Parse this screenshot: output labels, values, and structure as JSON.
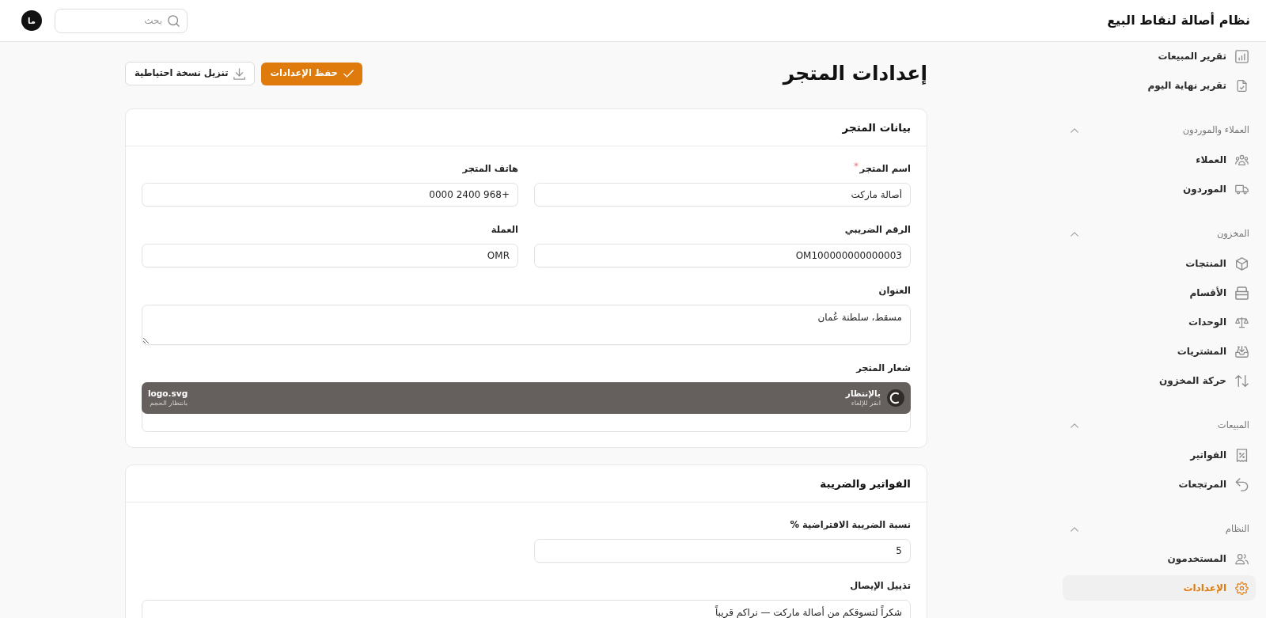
{
  "app": {
    "title": "نظام أصالة لنقاط البيع"
  },
  "search": {
    "placeholder": "بحث"
  },
  "user": {
    "initials": "ما"
  },
  "sidebar": {
    "sections": [
      {
        "items": [
          {
            "label": "تقرير المبيعات",
            "selected": false
          },
          {
            "label": "تقرير نهاية اليوم",
            "selected": false
          }
        ]
      },
      {
        "title": "العملاء والموردون",
        "expanded": true,
        "items": [
          {
            "label": "العملاء",
            "selected": false
          },
          {
            "label": "الموردون",
            "selected": false
          }
        ]
      },
      {
        "title": "المخزون",
        "expanded": true,
        "items": [
          {
            "label": "المنتجات",
            "selected": false
          },
          {
            "label": "الأقسام",
            "selected": false
          },
          {
            "label": "الوحدات",
            "selected": false
          },
          {
            "label": "المشتريات",
            "selected": false
          },
          {
            "label": "حركة المخزون",
            "selected": false
          }
        ]
      },
      {
        "title": "المبيعات",
        "expanded": true,
        "items": [
          {
            "label": "الفواتير",
            "selected": false
          },
          {
            "label": "المرتجعات",
            "selected": false
          }
        ]
      },
      {
        "title": "النظام",
        "expanded": true,
        "items": [
          {
            "label": "المستخدمون",
            "selected": false
          },
          {
            "label": "الإعدادات",
            "selected": true
          }
        ]
      }
    ]
  },
  "page": {
    "title": "إعدادات المتجر",
    "actions": [
      {
        "kind": "primary",
        "label": "حفظ الإعدادات"
      },
      {
        "kind": "secondary",
        "label": "تنزيل نسخة احتياطية"
      }
    ]
  },
  "sections": [
    {
      "title": "بيانات المتجر",
      "fields": [
        {
          "kind": "text",
          "label": "اسم المتجر",
          "required": true,
          "value": "أصالة ماركت"
        },
        {
          "kind": "text",
          "label": "هاتف المتجر",
          "required": false,
          "value": "+968 2400 0000"
        },
        {
          "kind": "text",
          "label": "الرقم الضريبي",
          "required": false,
          "value": "OM100000000000003"
        },
        {
          "kind": "text",
          "label": "العملة",
          "required": false,
          "value": "OMR"
        },
        {
          "kind": "textarea",
          "label": "العنوان",
          "required": false,
          "value": "مسقط، سلطنة عُمان"
        },
        {
          "kind": "upload",
          "label": "شعار المتجر",
          "required": false,
          "file": {
            "name": "logo.svg",
            "size": "بانتظار الحجم",
            "status": "بالإنتظار",
            "hint": "انقر للإلغاء"
          }
        }
      ]
    },
    {
      "title": "الفواتير والضريبة",
      "fields": [
        {
          "kind": "text",
          "label": "نسبة الضريبة الافتراضية %",
          "required": false,
          "value": "5"
        },
        {
          "kind": "textarea",
          "label": "تذييل الإيصال",
          "required": false,
          "value": "شكراً لتسوقكم من أصالة ماركت — نراكم قريباً"
        }
      ]
    }
  ]
}
